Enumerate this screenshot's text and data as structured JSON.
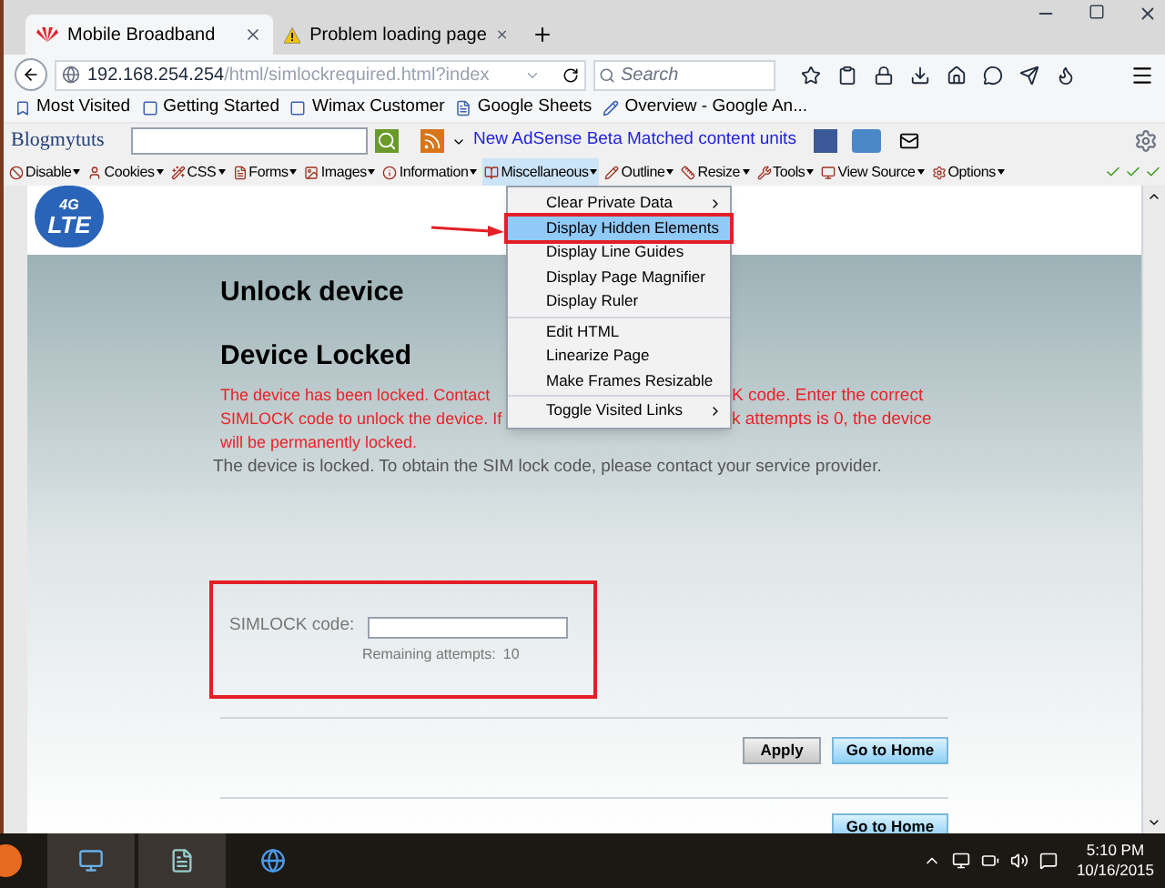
{
  "browser": {
    "tabs": [
      {
        "title": "Mobile Broadband",
        "selected": true,
        "kind": "huawei"
      },
      {
        "title": "Problem loading page",
        "selected": false,
        "kind": "warning"
      }
    ],
    "address": {
      "host": "192.168.254.254",
      "path": "/html/simlockrequired.html?index"
    },
    "search": {
      "placeholder": "Search"
    },
    "bookmarks": [
      "Most Visited",
      "Getting Started",
      "Wimax Customer",
      "Google Sheets",
      "Overview - Google An..."
    ],
    "addon_toolbar": {
      "brand": "Blogmytuts",
      "link": "New AdSense Beta Matched content units"
    },
    "devtools": [
      {
        "label": "Disable",
        "selected": false
      },
      {
        "label": "Cookies",
        "selected": false
      },
      {
        "label": "CSS",
        "selected": false
      },
      {
        "label": "Forms",
        "selected": false
      },
      {
        "label": "Images",
        "selected": false
      },
      {
        "label": "Information",
        "selected": false
      },
      {
        "label": "Miscellaneous",
        "selected": true
      },
      {
        "label": "Outline",
        "selected": false
      },
      {
        "label": "Resize",
        "selected": false
      },
      {
        "label": "Tools",
        "selected": false
      },
      {
        "label": "View Source",
        "selected": false
      },
      {
        "label": "Options",
        "selected": false
      }
    ],
    "menu": [
      {
        "label": "Clear Private Data",
        "submenu": true,
        "selected": false,
        "separator_before": false
      },
      {
        "label": "Display Hidden Elements",
        "submenu": false,
        "selected": true,
        "separator_before": false
      },
      {
        "label": "Display Line Guides",
        "submenu": false,
        "selected": false,
        "separator_before": false
      },
      {
        "label": "Display Page Magnifier",
        "submenu": false,
        "selected": false,
        "separator_before": false
      },
      {
        "label": "Display Ruler",
        "submenu": false,
        "selected": false,
        "separator_before": false
      },
      {
        "label": "Edit HTML",
        "submenu": false,
        "selected": false,
        "separator_before": true
      },
      {
        "label": "Linearize Page",
        "submenu": false,
        "selected": false,
        "separator_before": false
      },
      {
        "label": "Make Frames Resizable",
        "submenu": false,
        "selected": false,
        "separator_before": false
      },
      {
        "label": "Toggle Visited Links",
        "submenu": true,
        "selected": false,
        "separator_before": true
      }
    ]
  },
  "page": {
    "logo": {
      "line1": "4G",
      "line2": "LTE"
    },
    "title": "Unlock device",
    "heading": "Device Locked",
    "warning_lines": [
      {
        "left": "The device has been locked. Contact",
        "right": "K code. Enter the correct"
      },
      {
        "left": "SIMLOCK code to unlock the device. If",
        "right": "k attempts is 0, the device"
      },
      {
        "left": "will be permanently locked."
      }
    ],
    "info": "The device is locked. To obtain the SIM lock code, please contact your service provider.",
    "field": {
      "label": "SIMLOCK code:"
    },
    "attempts": {
      "label": "Remaining attempts:",
      "value": "10"
    },
    "buttons": [
      "Apply",
      "Go to Home"
    ],
    "bottom_button": "Go to Home"
  },
  "taskbar": {
    "time": "5:10 PM",
    "date": "10/16/2015"
  }
}
